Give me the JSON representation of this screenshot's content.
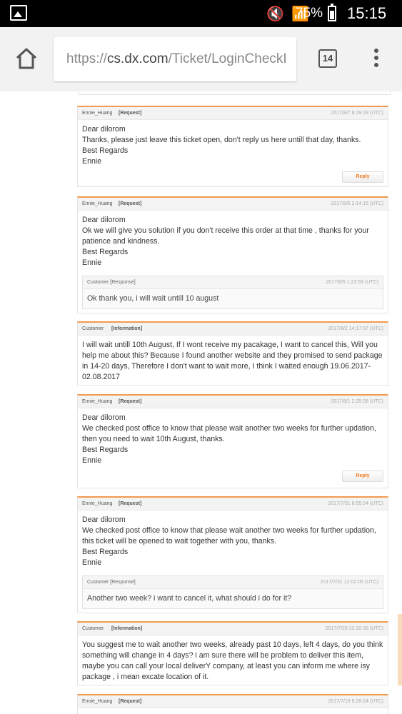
{
  "status_bar": {
    "battery_percent": "75%",
    "time": "15:15"
  },
  "browser": {
    "url_prefix": "https://",
    "url_host": "cs.dx.com",
    "url_path": "/Ticket/LoginCheckI",
    "tab_count": "14"
  },
  "messages": [
    {
      "author": "Ennie_Huang",
      "tag": "[Request]",
      "timestamp": "2017/8/7 8:29:29 (UTC)",
      "lines": [
        "Dear dilorom",
        "Thanks, please just leave this ticket open, don't reply us here untill that day, thanks.",
        "Best Regards",
        "Ennie"
      ],
      "reply_label": "Reply"
    },
    {
      "author": "Ennie_Huang",
      "tag": "[Request]",
      "timestamp": "2017/8/5 2:14:15 (UTC)",
      "lines": [
        "Dear dilorom",
        "Ok we will give you solution if you don't receive this order at that time , thanks for your patience and kindness.",
        "Best Regards",
        "Ennie"
      ],
      "sub": {
        "author": "Customer [Response]",
        "timestamp": "2017/8/5 1:23:59 (UTC)",
        "text": "Ok thank you, i will wait untill 10 august"
      }
    },
    {
      "author": "Customer",
      "tag": "[Information]",
      "timestamp": "2017/8/2 14:17:37 (UTC)",
      "lines": [
        "I will wait untill 10th August, If I wont receive my pacakage, I want to cancel this, Will you help me about this? Because I found another website and they promised to send package in 14-20 days, Therefore I don't want to wait more, I think I waited enough 19.06.2017-02.08.2017"
      ]
    },
    {
      "author": "Ennie_Huang",
      "tag": "[Request]",
      "timestamp": "2017/8/1 2:25:08 (UTC)",
      "lines": [
        "Dear dilorom",
        "We checked post office to know that please wait another two weeks for further updation, then you need to wait 10th August, thanks.",
        "Best Regards",
        "Ennie"
      ],
      "reply_label": "Reply"
    },
    {
      "author": "Ennie_Huang",
      "tag": "[Request]",
      "timestamp": "2017/7/31 8:55:04 (UTC)",
      "lines": [
        "Dear dilorom",
        "We checked post office to know that please wait another two weeks for further updation, this ticket will be opened to wait together with you, thanks.",
        "Best Regards",
        "Ennie"
      ],
      "sub": {
        "author": "Customer [Response]",
        "timestamp": "2017/7/31 12:02:05 (UTC)",
        "text": "Another two week? i want to cancel it, what should i do for it?"
      }
    },
    {
      "author": "Customer",
      "tag": "[Information]",
      "timestamp": "2017/7/29 22:32:36 (UTC)",
      "lines": [
        "You suggest me to wait another two weeks, already past 10 days, left 4 days, do you think something will change in 4 days? i am sure there will be problem to deliver this item, maybe you can call your local deliverY company, at least you can inform me where isy package , i mean excate location of it."
      ]
    },
    {
      "author": "Ennie_Huang",
      "tag": "[Request]",
      "timestamp": "2017/7/19 6:28:24 (UTC)",
      "lines": []
    }
  ]
}
